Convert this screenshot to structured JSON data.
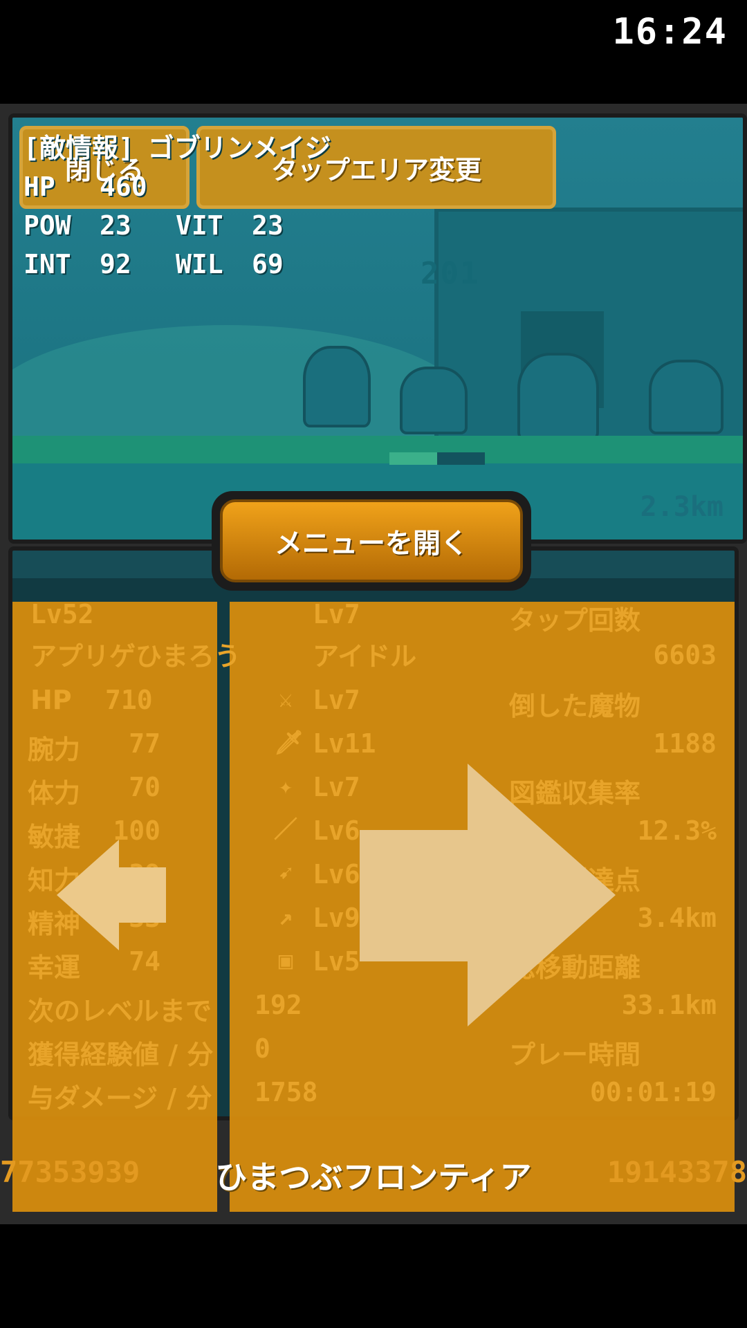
{
  "header": {
    "close_label": "閉じる",
    "tap_area_label": "タップエリア変更",
    "clock": "16:24"
  },
  "game_scene": {
    "floor_number": "201",
    "distance": "2.3km",
    "enemy_hp_fraction": 0.5
  },
  "enemy": {
    "title_tag": "[敵情報]",
    "name": "ゴブリンメイジ",
    "hp_label": "HP",
    "hp": "460",
    "pow_label": "POW",
    "pow": "23",
    "vit_label": "VIT",
    "vit": "23",
    "int_label": "INT",
    "int": "92",
    "wil_label": "WIL",
    "wil": "69"
  },
  "menu_button_label": "メニューを開く",
  "player": {
    "level": "Lv52",
    "name": "アプリゲひまろう",
    "stats": [
      {
        "label": "HP",
        "value": "710"
      },
      {
        "label": "腕力",
        "value": "77"
      },
      {
        "label": "体力",
        "value": "70"
      },
      {
        "label": "敏捷",
        "value": "100"
      },
      {
        "label": "知力",
        "value": "39"
      },
      {
        "label": "精神",
        "value": "33"
      },
      {
        "label": "幸運",
        "value": "74"
      }
    ],
    "next_level_label": "次のレベルまで",
    "next_level_value": "192",
    "exp_per_min_label": "獲得経験値 / 分",
    "exp_per_min_value": "0",
    "dmg_per_min_label": "与ダメージ / 分",
    "dmg_per_min_value": "1758"
  },
  "job": {
    "level": "Lv7",
    "name": "アイドル",
    "skills": [
      {
        "icon": "sword-icon",
        "glyph": "⚔",
        "level": "Lv7"
      },
      {
        "icon": "dagger-icon",
        "glyph": "🗡",
        "level": "Lv11"
      },
      {
        "icon": "axe-icon",
        "glyph": "✦",
        "level": "Lv7"
      },
      {
        "icon": "spear-icon",
        "glyph": "／",
        "level": "Lv6"
      },
      {
        "icon": "bow-icon",
        "glyph": "➹",
        "level": "Lv6"
      },
      {
        "icon": "staff-icon",
        "glyph": "↗",
        "level": "Lv9"
      },
      {
        "icon": "shield-icon",
        "glyph": "▣",
        "level": "Lv5"
      }
    ]
  },
  "records": [
    {
      "label": "タップ回数",
      "value": "6603"
    },
    {
      "label": "倒した魔物",
      "value": "1188"
    },
    {
      "label": "図鑑収集率",
      "value": "12.3%"
    },
    {
      "label": "最高到達点",
      "value": "3.4km"
    },
    {
      "label": "総移動距離",
      "value": "33.1km"
    },
    {
      "label": "プレー時間",
      "value": "00:01:19"
    }
  ],
  "footer": {
    "title": "ひまつぶフロンティア",
    "left_number": "77353939",
    "right_number": "19143378"
  },
  "colors": {
    "overlay": "#d38a0e",
    "stat_text": "#e8a42a",
    "button": "#c5901e",
    "menu_button": "#f0a21a"
  }
}
